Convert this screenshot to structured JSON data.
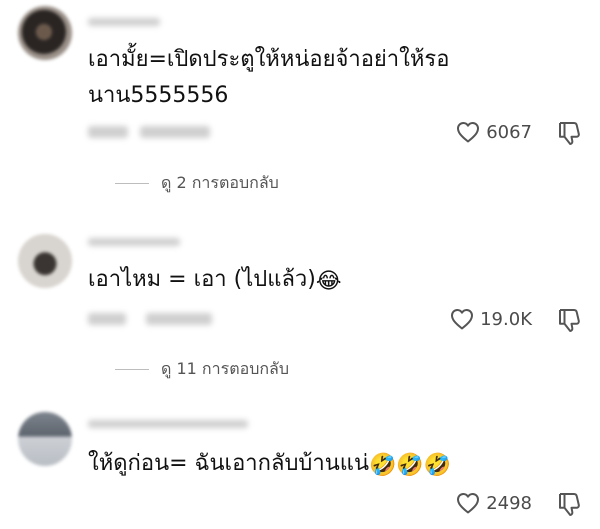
{
  "comments": [
    {
      "text": "เอามั้ย=เปิดประตูให้หน่อยจ้าอย่าให้รอนาน5555556",
      "text_line1": "เอามั้ย=เปิดประตูให้หน่อยจ้าอย่าให้รอ",
      "text_line2": "นาน5555556",
      "likes": "6067",
      "replies_label": "ดู 2 การตอบกลับ"
    },
    {
      "text": "เอาไหม = เอา (ไปแล้ว)",
      "emoji": "😂",
      "likes": "19.0K",
      "replies_label": "ดู 11 การตอบกลับ"
    },
    {
      "text": "ให้ดูก่อน= ฉันเอากลับบ้านแน่",
      "emoji": "🤣🤣🤣",
      "likes": "2498"
    }
  ],
  "icons": {
    "like": "heart-outline-icon",
    "dislike": "thumbs-down-outline-icon"
  }
}
